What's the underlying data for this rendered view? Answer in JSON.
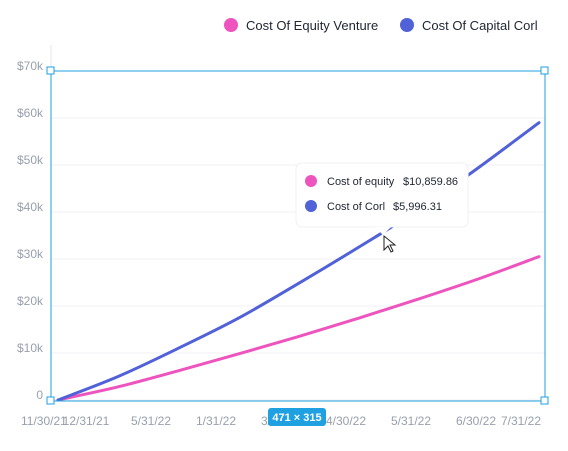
{
  "chart_data": {
    "type": "line",
    "x": [
      "11/30/21",
      "12/31/21",
      "5/31/22",
      "1/31/22",
      "3/30/22",
      "4/30/22",
      "5/31/22",
      "6/30/22",
      "7/31/22"
    ],
    "y_ticks": [
      "0",
      "$10k",
      "$20k",
      "$30k",
      "$40k",
      "$50k",
      "$60k",
      "$70k"
    ],
    "ylim": [
      0,
      70000
    ],
    "series": [
      {
        "name": "Cost Of Equity Venture",
        "color": "#ee54be",
        "values": [
          0,
          2800,
          6200,
          9800,
          13500,
          17400,
          21500,
          25800,
          30500
        ]
      },
      {
        "name": "Cost Of Capital Corl",
        "color": "#5161d8",
        "values": [
          0,
          5000,
          11000,
          17400,
          24800,
          32500,
          40500,
          49500,
          59000
        ]
      }
    ],
    "legend_position": "top-right",
    "grid": true
  },
  "tooltip": {
    "rows": [
      {
        "label": "Cost of equity",
        "value": "$10,859.86",
        "color": "#ee54be"
      },
      {
        "label": "Cost of Corl",
        "value": "$5,996.31",
        "color": "#5161d8"
      }
    ]
  },
  "selection": {
    "size_label": "471 × 315",
    "accent": "#1fa0e0"
  }
}
